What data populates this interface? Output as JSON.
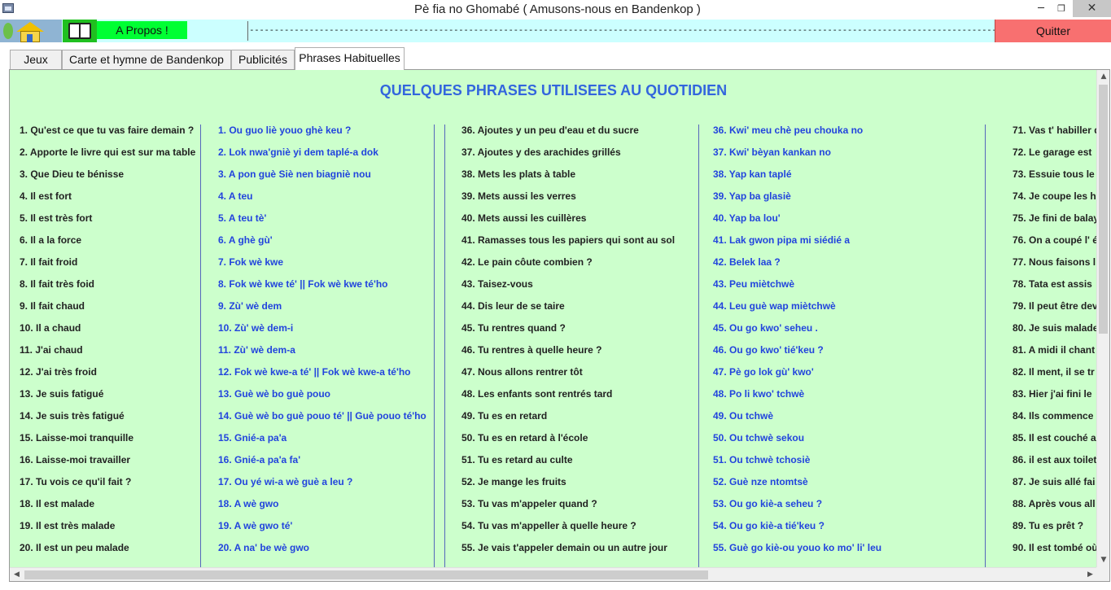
{
  "window": {
    "title": "Pè fia no Ghomabé ( Amusons-nous en Bandenkop )",
    "minimize_glyph": "─",
    "maximize_glyph": "❐",
    "close_glyph": "✕"
  },
  "toolbar": {
    "apropos_label": "A Propos !",
    "marquee_text": "------------------------------------------------------------------------------------------------------------------------------------------------------------------------------------------>>>>>>>>>>>>>>>",
    "quit_label": "Quitter",
    "icons": [
      "home-icon",
      "book-icon"
    ]
  },
  "tabs": [
    {
      "label": "Jeux"
    },
    {
      "label": "Carte et hymne de Bandenkop"
    },
    {
      "label": "Publicités"
    },
    {
      "label": "Phrases Habituelles"
    }
  ],
  "active_tab": "Phrases Habituelles",
  "panel": {
    "title": "QUELQUES PHRASES UTILISEES AU QUOTIDIEN",
    "colors": {
      "background": "#ccffcc",
      "title": "#3366dd",
      "french_text": "#222222",
      "ghomala_text": "#2244dd"
    },
    "col_a": [
      "1. Qu'est ce que tu vas faire demain ?",
      "2. Apporte le livre qui est sur ma table",
      "3. Que Dieu te bénisse",
      "4. Il est fort",
      "5. Il est très fort",
      "6. Il a la force",
      "7. Il fait froid",
      "8. Il fait très foid",
      "9. Il fait chaud",
      "10. Il a chaud",
      "11. J'ai chaud",
      "12. J'ai très froid",
      "13. Je suis fatigué",
      "14. Je suis très fatigué",
      "15. Laisse-moi tranquille",
      "16. Laisse-moi travailler",
      "17. Tu vois ce qu'il fait ?",
      "18. Il est malade",
      "19. Il est très malade",
      "20. Il est un peu malade"
    ],
    "col_b": [
      "1. Ou guo liè youo ghè keu ?",
      "2. Lok nwa'gniè yi dem taplé-a dok",
      "3. A pon guè Siè nen biagniè nou",
      "4. A teu",
      "5. A teu tè'",
      "6. A ghè gù'",
      "7. Fok wè kwe",
      "8. Fok wè kwe té'  ||  Fok wè kwe té'ho",
      "9. Zù' wè dem",
      "10. Zù' wè dem-i",
      "11. Zù' wè dem-a",
      "12. Fok wè kwe-a té' || Fok wè kwe-a té'ho",
      "13. Guè wè bo guè pouo",
      "14. Guè wè bo guè pouo té' || Guè pouo té'ho",
      "15. Gnié-a pa'a",
      "16. Gnié-a pa'a fa'",
      "17. Ou yé wi-a wè guè a leu ?",
      "18. A wè gwo",
      "19. A wè gwo té'",
      "20. A na' be wè gwo"
    ],
    "col_c": [
      "36. Ajoutes y un peu d'eau et du sucre",
      "37. Ajoutes y des arachides grillés",
      "38. Mets les plats à table",
      "39. Mets aussi les verres",
      "40. Mets aussi les cuillères",
      "41. Ramasses tous les papiers qui sont au sol",
      "42. Le pain côute combien ?",
      "43. Taisez-vous",
      "44. Dis leur de se taire",
      "45. Tu rentres quand ?",
      "46. Tu rentres à quelle heure ?",
      "47. Nous allons rentrer tôt",
      "48. Les enfants sont rentrés tard",
      "49. Tu es en retard",
      "50. Tu es en retard à l'école",
      "51. Tu es retard au culte",
      "52. Je mange les fruits",
      "53. Tu vas m'appeler quand ?",
      "54. Tu vas m'appeller à quelle heure ?",
      "55. Je vais t'appeler demain ou un autre jour"
    ],
    "col_d": [
      "36. Kwi' meu chè peu chouka no",
      "37. Kwi' bèyan kankan no",
      "38. Yap kan taplé",
      "39. Yap ba glasiè",
      "40. Yap ba lou'",
      "41. Lak gwon pipa mi siédié a",
      "42. Belek laa ?",
      "43. Peu miètchwè",
      "44. Leu guè wap miètchwè",
      "45. Ou go kwo' seheu .",
      "46. Ou go kwo' tié'keu ?",
      "47. Pè go lok gù' kwo'",
      "48. Po li kwo' tchwè",
      "49. Ou tchwè",
      "50. Ou tchwè sekou",
      "51. Ou tchwè tchosiè",
      "52. Guè nze ntomtsè",
      "53. Ou go kiè-a seheu ?",
      "54. Ou go kiè-a tié'keu ?",
      "55. Guè go kiè-ou youo ko mo' li' leu"
    ],
    "col_e": [
      "71. Vas t' habiller d",
      "72. Le garage est",
      "73. Essuie tous le",
      "74. Je coupe les h",
      "75. Je fini de balay",
      "76. On a coupé l' é",
      "77. Nous faisons l",
      "78. Tata est assis",
      "79. Il peut être dev",
      "80. Je suis malade",
      "81. A midi il chant",
      "82. Il ment, il se tr",
      "83. Hier j'ai fini le",
      "84. Ils commence",
      "85. Il est couché a",
      "86. il est aux toilet",
      "87. Je suis allé fai",
      "88. Après vous all",
      "89. Tu es prêt ?",
      "90. Il est tombé où"
    ]
  },
  "scrollbars": {
    "up_glyph": "▲",
    "down_glyph": "▼",
    "left_glyph": "◀",
    "right_glyph": "▶"
  }
}
